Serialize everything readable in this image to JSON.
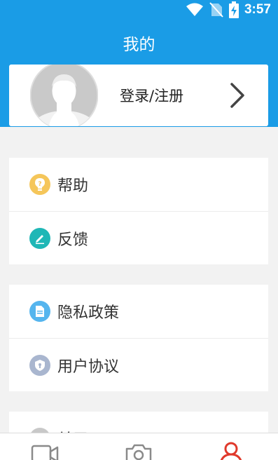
{
  "status_bar": {
    "time": "3:57"
  },
  "header": {
    "title": "我的"
  },
  "profile": {
    "login_label": "登录/注册"
  },
  "menu_groups": [
    {
      "items": [
        {
          "label": "帮助",
          "icon": "lightbulb-icon",
          "color": "#f5c65a"
        },
        {
          "label": "反馈",
          "icon": "edit-icon",
          "color": "#1fb7b6"
        }
      ]
    },
    {
      "items": [
        {
          "label": "隐私政策",
          "icon": "document-icon",
          "color": "#55b5ee"
        },
        {
          "label": "用户协议",
          "icon": "shield-icon",
          "color": "#a9b6cf"
        }
      ]
    },
    {
      "items": [
        {
          "label": "关于",
          "icon": "info-icon",
          "color": "#c8c8c8"
        }
      ]
    }
  ],
  "bottom_nav": [
    {
      "icon": "video-icon",
      "active": false
    },
    {
      "icon": "camera-icon",
      "active": false
    },
    {
      "icon": "user-icon",
      "active": true
    }
  ],
  "colors": {
    "primary": "#1a9ce6",
    "active_tab": "#e0392b",
    "background": "#f2f2f2"
  }
}
